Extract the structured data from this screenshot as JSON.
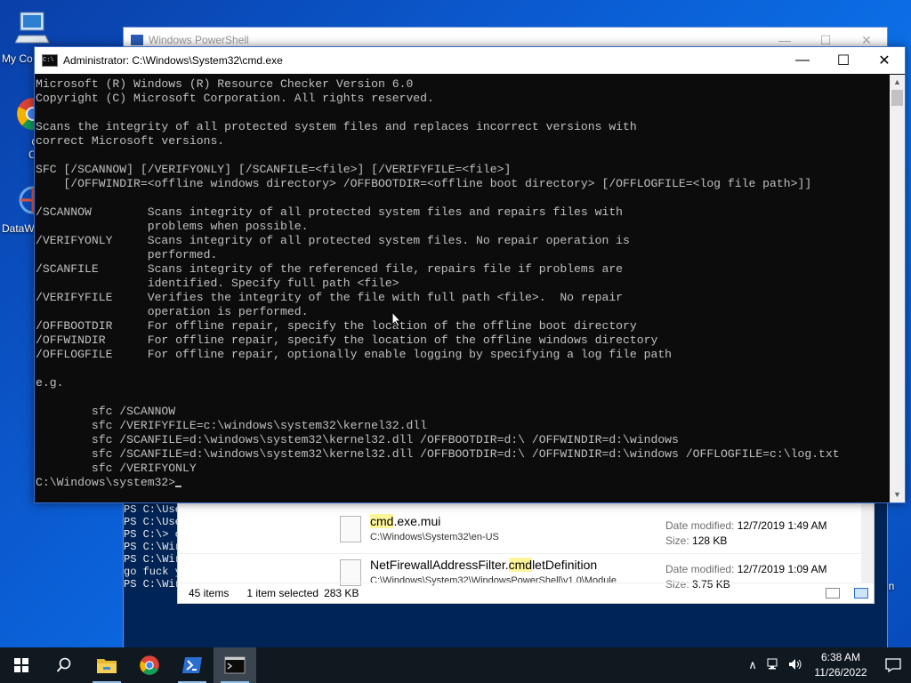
{
  "desktop": {
    "icons": [
      {
        "label": "My Co"
      },
      {
        "label": "Goo\nChro"
      },
      {
        "label": "DataW"
      }
    ],
    "right_label": "in"
  },
  "powershell": {
    "title": "Windows PowerShell",
    "lines": [
      "PS C:\\Use",
      "PS C:\\Use",
      "PS C:\\> c",
      "PS C:\\Wir",
      "PS C:\\Wir",
      "go fuck y",
      "PS C:\\Wir"
    ]
  },
  "explorer": {
    "results": [
      {
        "name_hl": "cmd",
        "name_rest": ".exe.mui",
        "path": "C:\\Windows\\System32\\en-US",
        "date_label": "Date modified:",
        "date": "12/7/2019 1:49 AM",
        "size_label": "Size:",
        "size": "128 KB"
      },
      {
        "name_pre": "NetFirewallAddressFilter.",
        "name_hl": "cmd",
        "name_rest": "letDefinition",
        "path": "C:\\Windows\\System32\\WindowsPowerShell\\v1.0\\Module",
        "date_label": "Date modified:",
        "date": "12/7/2019 1:09 AM",
        "size_label": "Size:",
        "size": "3.75 KB"
      }
    ],
    "status": {
      "count": "45 items",
      "selected": "1 item selected",
      "size": "283 KB"
    }
  },
  "cmd": {
    "title": "Administrator: C:\\Windows\\System32\\cmd.exe",
    "icon_text": "C:\\",
    "controls": {
      "minimize": "—",
      "maximize": "☐",
      "close": "✕"
    },
    "output": "Microsoft (R) Windows (R) Resource Checker Version 6.0\nCopyright (C) Microsoft Corporation. All rights reserved.\n\nScans the integrity of all protected system files and replaces incorrect versions with\ncorrect Microsoft versions.\n\nSFC [/SCANNOW] [/VERIFYONLY] [/SCANFILE=<file>] [/VERIFYFILE=<file>]\n    [/OFFWINDIR=<offline windows directory> /OFFBOOTDIR=<offline boot directory> [/OFFLOGFILE=<log file path>]]\n\n/SCANNOW        Scans integrity of all protected system files and repairs files with\n                problems when possible.\n/VERIFYONLY     Scans integrity of all protected system files. No repair operation is\n                performed.\n/SCANFILE       Scans integrity of the referenced file, repairs file if problems are\n                identified. Specify full path <file>\n/VERIFYFILE     Verifies the integrity of the file with full path <file>.  No repair\n                operation is performed.\n/OFFBOOTDIR     For offline repair, specify the location of the offline boot directory\n/OFFWINDIR      For offline repair, specify the location of the offline windows directory\n/OFFLOGFILE     For offline repair, optionally enable logging by specifying a log file path\n\ne.g.\n\n        sfc /SCANNOW\n        sfc /VERIFYFILE=c:\\windows\\system32\\kernel32.dll\n        sfc /SCANFILE=d:\\windows\\system32\\kernel32.dll /OFFBOOTDIR=d:\\ /OFFWINDIR=d:\\windows\n        sfc /SCANFILE=d:\\windows\\system32\\kernel32.dll /OFFBOOTDIR=d:\\ /OFFWINDIR=d:\\windows /OFFLOGFILE=c:\\log.txt\n        sfc /VERIFYONLY\n",
    "prompt": "C:\\Windows\\system32>"
  },
  "taskbar": {
    "items": [
      "start-icon",
      "search-icon",
      "file-explorer-icon",
      "chrome-icon",
      "powershell-icon",
      "cmd-icon"
    ],
    "active_item": "cmd-icon",
    "tray": {
      "time": "6:38 AM",
      "date": "11/26/2022"
    }
  }
}
